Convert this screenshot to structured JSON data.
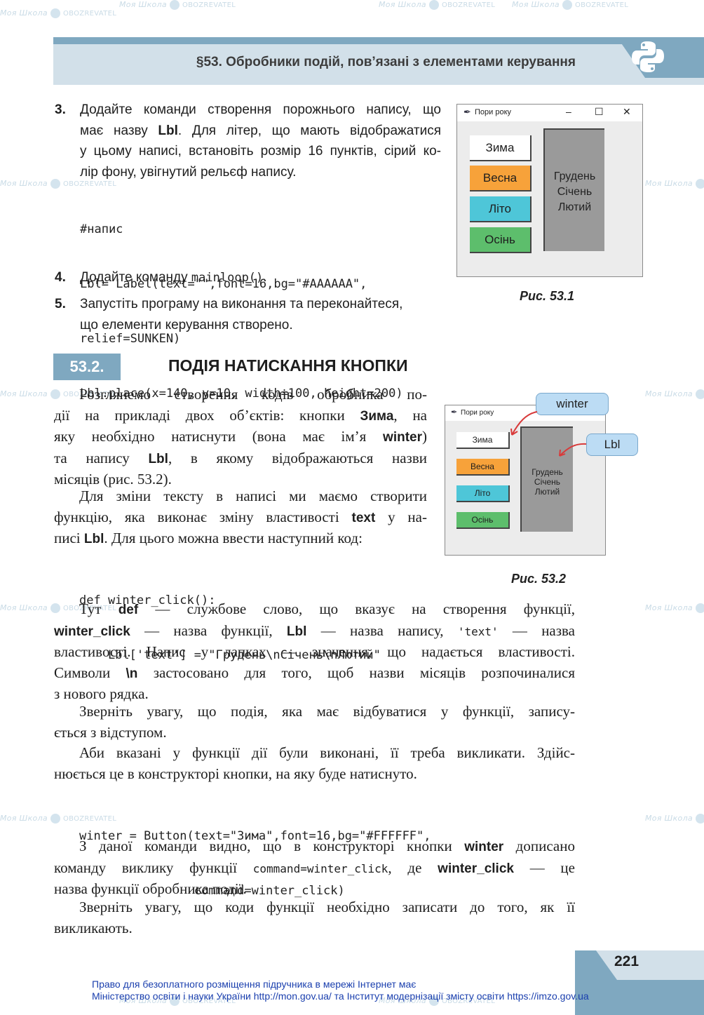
{
  "header": {
    "title": "§53. Обробники подій, пов’язані з елементами керування",
    "logo_icon": "python-logo-icon"
  },
  "steps": [
    {
      "num": "3.",
      "lines": [
        "Додайте команди створення порожнього напису, що",
        "має назву ",
        "у цьому написі, встановіть розмір 16 пунктів, сірий ко-",
        "лір фону, увігнутий рельєф напису."
      ],
      "bold_word": "Lbl",
      "line2_rest": ". Для літер, що мають відображатися",
      "code": [
        "#напис",
        "Lbl= Label(text=\"\",font=16,bg=\"#AAAAAA\",",
        "relief=SUNKEN)",
        "Lbl.place(x=140, y=10, width=100, height=200)"
      ]
    },
    {
      "num": "4.",
      "text": "Додайте команду ",
      "code": "mainloop()",
      "after": "."
    },
    {
      "num": "5.",
      "lines": [
        "Запустіть програму на виконання та переконайтеся,",
        "що елементи керування створено."
      ]
    }
  ],
  "figure1": {
    "window_title": "Пори року",
    "buttons": [
      {
        "label": "Зима",
        "color": "#FFFFFF"
      },
      {
        "label": "Весна",
        "color": "#F7A23A"
      },
      {
        "label": "Літо",
        "color": "#4EC6D8"
      },
      {
        "label": "Осінь",
        "color": "#5DBE6C"
      }
    ],
    "label_lines": [
      "Грудень",
      "Січень",
      "Лютий"
    ],
    "label_color": "#9A9A9A",
    "caption": "Рис. 53.1",
    "controls": {
      "minimize": "–",
      "maximize": "☐",
      "close": "✕"
    }
  },
  "section": {
    "number": "53.2.",
    "title": "ПОДІЯ НАТИСКАННЯ КНОПКИ"
  },
  "paragraphs": {
    "p1": {
      "l1": "Розглянемо створення кодів обробника по-",
      "l2a": "дії на прикладі двох об’єктів: кнопки ",
      "l2b": "Зима",
      "l2c": ", на",
      "l3a": "яку необхідно натиснути (вона має ім’я ",
      "l3b": "winter",
      "l3c": ")",
      "l4a": "та напису ",
      "l4b": "Lbl",
      "l4c": ", в якому відображаються назви",
      "l5": "місяців (рис. 53.2)."
    },
    "p2": {
      "l1": "Для зміни тексту в написі ми маємо створити",
      "l2a": "функцію, яка виконає зміну властивості ",
      "l2b": "text",
      "l2c": " у на-",
      "l3a": "писі ",
      "l3b": "Lbl",
      "l3c": ". Для цього можна ввести наступний код:"
    },
    "code1": [
      "def winter_click():",
      "    Lbl['text'] = \"Грудень\\nСічень\\nЛютий\""
    ],
    "p3": {
      "l1a": "Тут ",
      "l1b": "def",
      "l1c": " — службове слово, що вказує на створення функції,",
      "l2a": "winter_click",
      "l2b": " — назва функції, ",
      "l2c": "Lbl",
      "l2d": " — назва напису, ",
      "l2e": "'text'",
      "l2f": " — назва",
      "l3": "властивості. Напис у лапках — значення, що надається властивості.",
      "l4a": "Символи ",
      "l4b": "\\n",
      "l4c": " застосовано для того, щоб назви місяців розпочиналися",
      "l5": "з нового рядка."
    },
    "p4": {
      "l1": "Зверніть увагу, що подія, яка має відбуватися у функції, запису-",
      "l2": "ється з відступом."
    },
    "p5": {
      "l1": "Аби вказані у функції дії були виконані, її треба викликати. Здійс-",
      "l2": "нюється це в конструкторі кнопки, на яку буде натиснуто."
    },
    "code2": [
      "winter = Button(text=\"Зима\",font=16,bg=\"#FFFFFF\",",
      "                command=winter_click)"
    ],
    "p6": {
      "l1a": "З даної команди видно, що в конструкторі кнопки ",
      "l1b": "winter",
      "l1c": " дописано",
      "l2a": "команду виклику функції ",
      "l2b": "command=winter_click",
      "l2c": ", де ",
      "l2d": "winter_click",
      "l2e": " — це",
      "l3": "назва функції обробника події."
    },
    "p7": {
      "l1": "Зверніть увагу, що коди функції необхідно записати до того, як її",
      "l2": "викликають."
    }
  },
  "figure2": {
    "window_title": "Пори року",
    "buttons": [
      {
        "label": "Зима",
        "color": "#FFFFFF"
      },
      {
        "label": "Весна",
        "color": "#F7A23A"
      },
      {
        "label": "Літо",
        "color": "#4EC6D8"
      },
      {
        "label": "Осінь",
        "color": "#5DBE6C"
      }
    ],
    "label_lines": [
      "Грудень",
      "Січень",
      "Лютий"
    ],
    "callouts": [
      {
        "text": "winter"
      },
      {
        "text": "Lbl"
      }
    ],
    "caption": "Рис. 53.2"
  },
  "footer": {
    "page_number": "221",
    "note_line1": "Право для безоплатного розміщення підручника в мережі Інтернет має",
    "note_line2": "Міністерство освіти і науки України http://mon.gov.ua/ та Інститут модернізації змісту освіти https://imzo.gov.ua"
  },
  "watermark": {
    "brand1": "Моя Школа",
    "brand2": "OBOZREVATEL"
  },
  "colors": {
    "accent": "#7FA8C0",
    "accent_light": "#D2E0E9",
    "footer_link": "#1A3FAE"
  }
}
